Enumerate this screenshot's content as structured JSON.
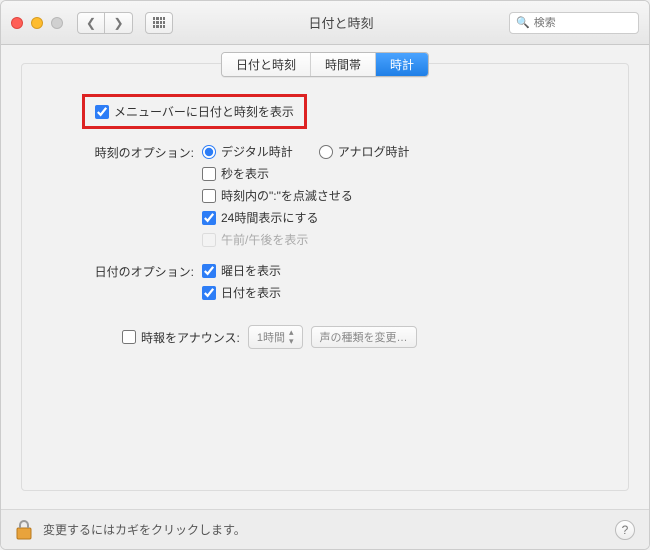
{
  "window": {
    "title": "日付と時刻",
    "search_placeholder": "検索"
  },
  "tabs": {
    "date_time": "日付と時刻",
    "timezone": "時間帯",
    "clock": "時計"
  },
  "clock_pane": {
    "show_in_menubar": "メニューバーに日付と時刻を表示",
    "time_options_label": "時刻のオプション:",
    "digital_clock": "デジタル時計",
    "analog_clock": "アナログ時計",
    "show_seconds": "秒を表示",
    "flash_separators": "時刻内の\":\"を点滅させる",
    "use_24h": "24時間表示にする",
    "show_ampm": "午前/午後を表示",
    "date_options_label": "日付のオプション:",
    "show_day": "曜日を表示",
    "show_date": "日付を表示",
    "announce_label": "時報をアナウンス:",
    "announce_interval": "1時間",
    "voice_button": "声の種類を変更…"
  },
  "footer": {
    "lock_text": "変更するにはカギをクリックします。"
  }
}
